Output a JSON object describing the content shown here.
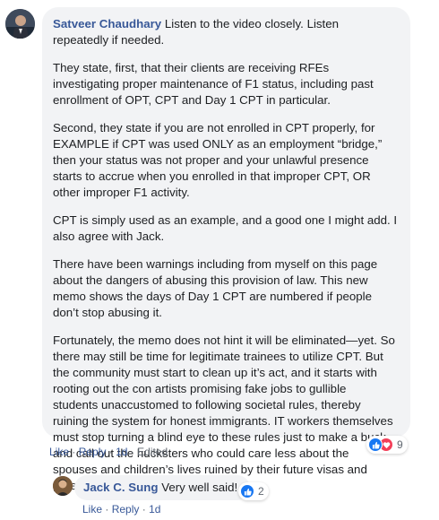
{
  "comment": {
    "author": "Satveer Chaudhary",
    "paragraphs": [
      " Listen to the video closely. Listen\nrepeatedly if needed.",
      "They state, first, that their clients are receiving RFEs\ninvestigating proper maintenance of F1 status, including past\nenrollment of OPT, CPT and Day 1 CPT in particular.",
      "Second, they state if you are not enrolled in CPT properly, for\nEXAMPLE if CPT was used ONLY as an employment “bridge,”\nthen your status was not proper and your unlawful presence\nstarts to accrue when you enrolled in that improper CPT, OR\nother improper F1 activity.",
      "CPT is simply used as an example, and a good one I might add. I\nalso agree with Jack.",
      "There have been warnings including from myself on this page\nabout the dangers of abusing this provision of law. This new\nmemo shows the days of Day 1 CPT are numbered if people\ndon’t stop abusing it.",
      "Fortunately, the memo does not hint it will be eliminated—yet. So\nthere may still be time for legitimate trainees to utilize CPT. But\nthe community must start to clean up it’s act, and it starts with\nrooting out the con artists promising fake jobs to gullible\nstudents unaccustomed to following societal rules, thereby\nruining the system for honest immigrants. IT workers themselves\nmust stop turning a blind eye to these rules just to make a buck,\nand call out the hucksters who could care less about the\nspouses and children’s lives ruined by their future visas and\ngreen cards being denied."
    ],
    "actions": {
      "like": "Like",
      "reply": "Reply",
      "time": "1d",
      "edited": "Edited"
    },
    "reaction_count": "9"
  },
  "reply": {
    "author": "Jack C. Sung",
    "text": " Very well said!",
    "actions": {
      "like": "Like",
      "reply": "Reply",
      "time": "1d"
    },
    "reaction_count": "2"
  },
  "icons": {
    "like": "thumbs-up-icon",
    "love": "heart-icon"
  },
  "colors": {
    "name_link": "#385898",
    "bubble_bg": "#f2f3f5",
    "like_blue": "#1877f2",
    "love_red": "#f33e58",
    "meta_gray": "#606770"
  }
}
